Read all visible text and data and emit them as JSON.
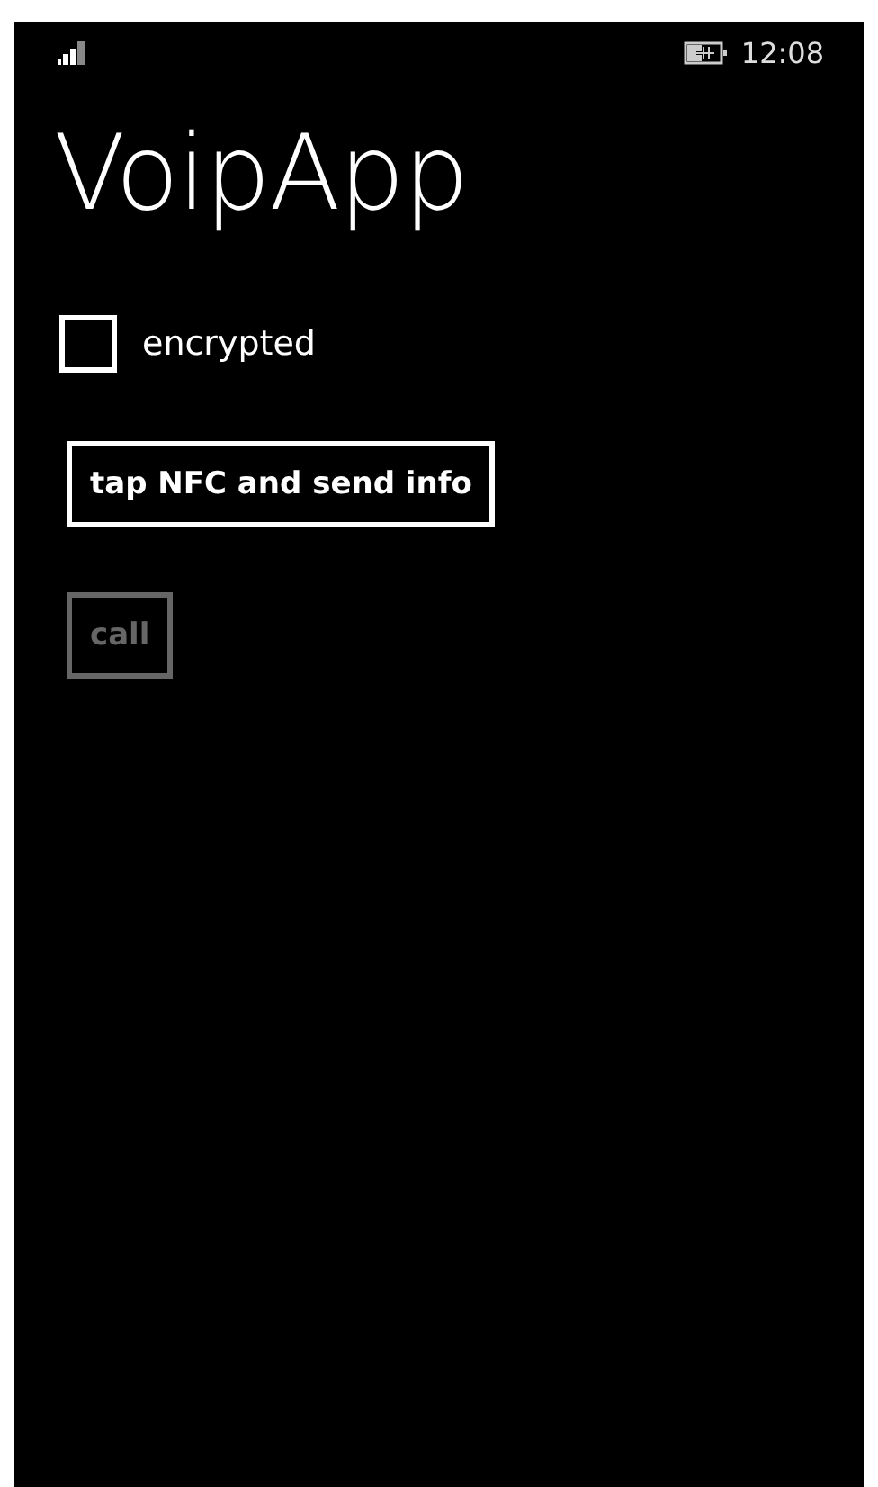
{
  "status_bar": {
    "time": "12:08"
  },
  "title": "VoipApp",
  "checkbox": {
    "label": "encrypted",
    "checked": false
  },
  "buttons": [
    {
      "label": "tap NFC and send info",
      "disabled": false
    },
    {
      "label": "call",
      "disabled": true
    }
  ]
}
